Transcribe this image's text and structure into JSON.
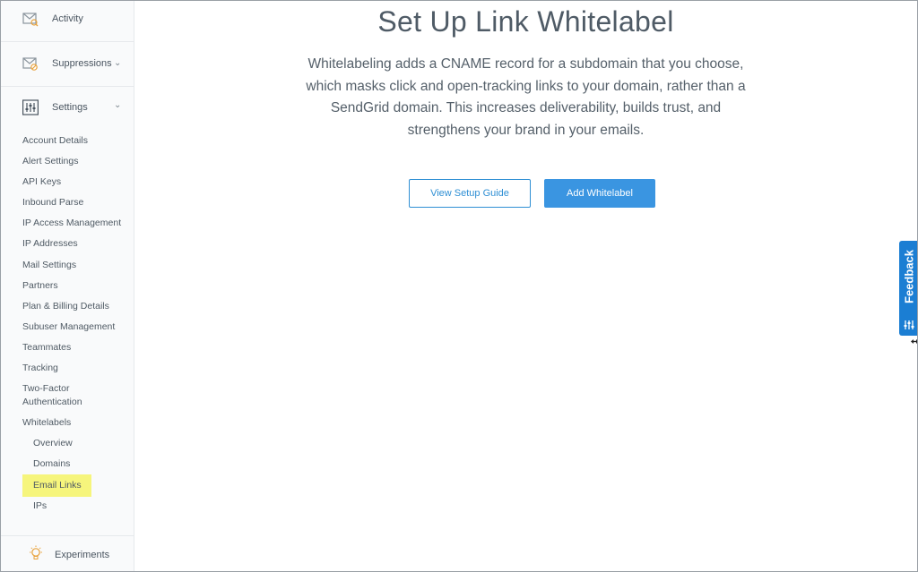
{
  "sidebar": {
    "activity": {
      "label": "Activity",
      "icon": "activity-icon"
    },
    "suppressions": {
      "label": "Suppressions",
      "icon": "suppressions-icon"
    },
    "settings": {
      "label": "Settings",
      "icon": "settings-sliders-icon"
    },
    "items": [
      {
        "label": "Account Details"
      },
      {
        "label": "Alert Settings"
      },
      {
        "label": "API Keys"
      },
      {
        "label": "Inbound Parse"
      },
      {
        "label": "IP Access Management"
      },
      {
        "label": "IP Addresses"
      },
      {
        "label": "Mail Settings"
      },
      {
        "label": "Partners"
      },
      {
        "label": "Plan & Billing Details"
      },
      {
        "label": "Subuser Management"
      },
      {
        "label": "Teammates"
      },
      {
        "label": "Tracking"
      },
      {
        "label": "Two-Factor"
      },
      {
        "label": "Authentication"
      },
      {
        "label": "Whitelabels"
      }
    ],
    "whitelabel_children": [
      {
        "label": "Overview"
      },
      {
        "label": "Domains"
      },
      {
        "label": "Email Links"
      },
      {
        "label": "IPs"
      }
    ],
    "experiments": {
      "label": "Experiments",
      "icon": "lightbulb-icon"
    }
  },
  "main": {
    "title": "Set Up Link Whitelabel",
    "description": "Whitelabeling adds a CNAME record for a subdomain that you choose, which masks click and open-tracking links to your domain, rather than a SendGrid domain. This increases deliverability, builds trust, and strengthens your brand in your emails.",
    "buttons": {
      "guide": "View Setup Guide",
      "add": "Add Whitelabel"
    }
  },
  "feedback": {
    "label": "Feedback",
    "icon": "feedback-sliders-icon"
  },
  "colors": {
    "accent": "#3a95e1",
    "feedback": "#1b7ed3",
    "highlight": "#f6f57c",
    "sidebar_bg": "#f9fafb"
  }
}
